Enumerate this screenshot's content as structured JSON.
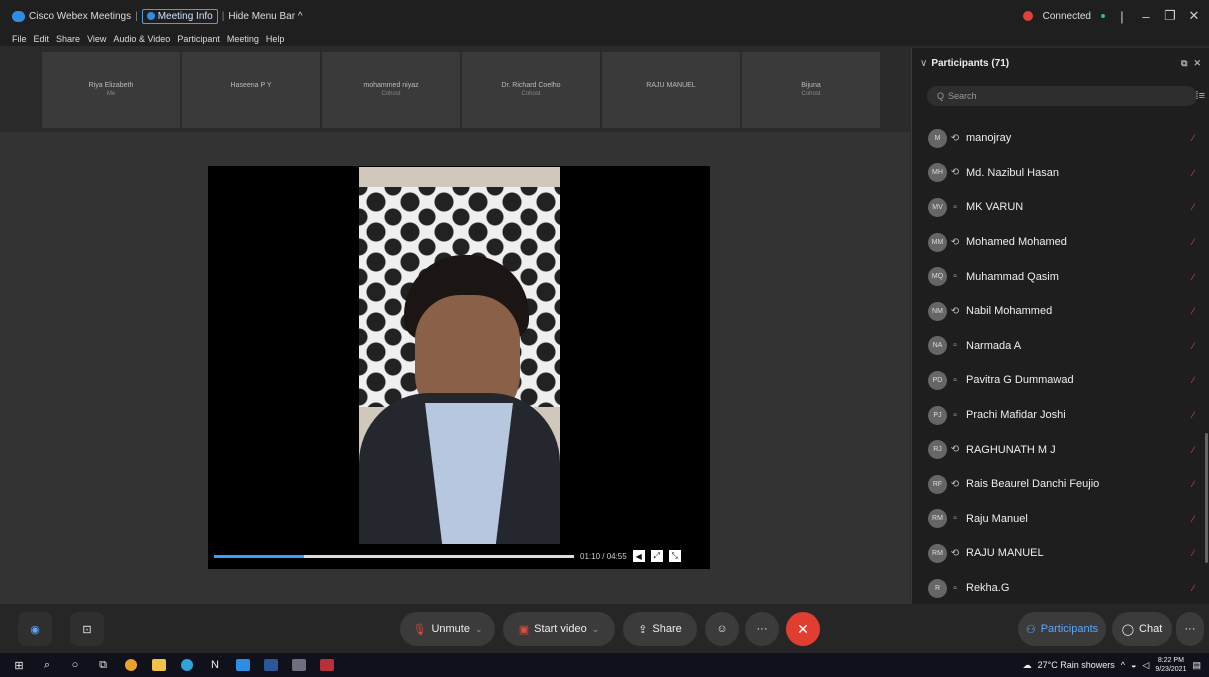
{
  "titlebar": {
    "app_name": "Cisco Webex Meetings",
    "meeting_info": "Meeting Info",
    "hide_menu": "Hide Menu Bar",
    "status": "Connected"
  },
  "menu": [
    "File",
    "Edit",
    "Share",
    "View",
    "Audio & Video",
    "Participant",
    "Meeting",
    "Help"
  ],
  "tiles": [
    {
      "name": "Riya Elizabeth",
      "role": "Me"
    },
    {
      "name": "Haseena P Y",
      "role": ""
    },
    {
      "name": "mohammed niyaz",
      "role": "Cohost"
    },
    {
      "name": "Dr. Richard Coelho",
      "role": "Cohost"
    },
    {
      "name": "RAJU MANUEL",
      "role": ""
    },
    {
      "name": "Bijuna",
      "role": "Cohost"
    }
  ],
  "video": {
    "time": "01:10 / 04:55",
    "progress": 0.25
  },
  "participants": {
    "title": "Participants (71)",
    "search_placeholder": "Search",
    "items": [
      {
        "initials": "M",
        "name": "manojray",
        "device": "phone"
      },
      {
        "initials": "MH",
        "name": "Md. Nazibul Hasan",
        "device": "phone"
      },
      {
        "initials": "MV",
        "name": "MK VARUN",
        "device": "desktop"
      },
      {
        "initials": "MM",
        "name": "Mohamed Mohamed",
        "device": "phone"
      },
      {
        "initials": "MQ",
        "name": "Muhammad Qasim",
        "device": "desktop"
      },
      {
        "initials": "NM",
        "name": "Nabil Mohammed",
        "device": "phone"
      },
      {
        "initials": "NA",
        "name": "Narmada A",
        "device": "desktop"
      },
      {
        "initials": "PD",
        "name": "Pavitra G Dummawad",
        "device": "desktop"
      },
      {
        "initials": "PJ",
        "name": "Prachi Mafidar Joshi",
        "device": "desktop"
      },
      {
        "initials": "RJ",
        "name": "RAGHUNATH M J",
        "device": "phone"
      },
      {
        "initials": "RF",
        "name": "Rais Beaurel Danchi Feujio",
        "device": "phone"
      },
      {
        "initials": "RM",
        "name": "Raju Manuel",
        "device": "desktop"
      },
      {
        "initials": "RM",
        "name": "RAJU MANUEL",
        "device": "phone"
      },
      {
        "initials": "R",
        "name": "Rekha.G",
        "device": "desktop"
      }
    ]
  },
  "bottom": {
    "unmute": "Unmute",
    "start_video": "Start video",
    "share": "Share",
    "participants": "Participants",
    "chat": "Chat"
  },
  "taskbar": {
    "weather": "27°C  Rain showers",
    "time": "8:22 PM",
    "date": "9/23/2021"
  },
  "colors": {
    "accent": "#2d8de2",
    "end_call": "#e03e31",
    "mute": "#e04a3a"
  }
}
